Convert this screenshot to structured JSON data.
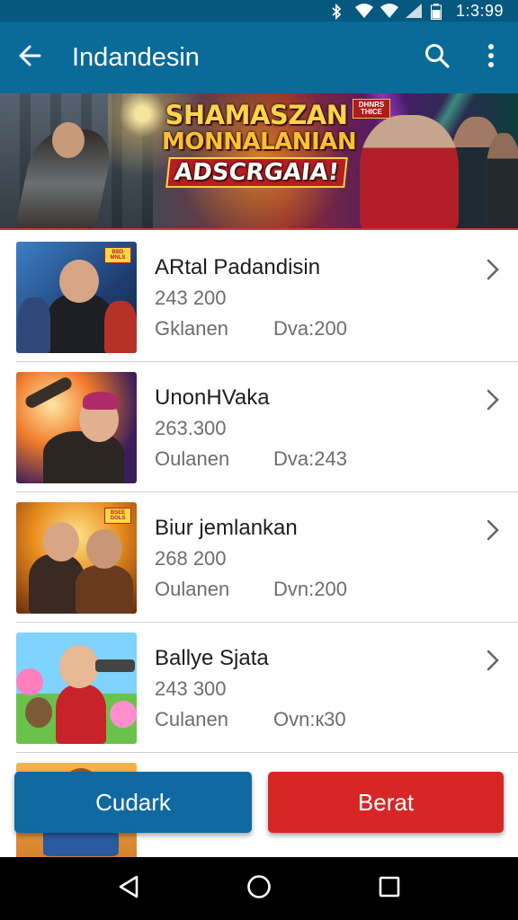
{
  "status_bar": {
    "time": "1:3:99",
    "icons": [
      "bluetooth-icon",
      "wifi-icon",
      "signal-icon",
      "battery-icon"
    ]
  },
  "app_bar": {
    "title": "Indandesin",
    "icons": [
      "back-arrow-icon",
      "search-icon",
      "more-vert-icon"
    ]
  },
  "banner": {
    "headline_1": "SHAMASZAN",
    "headline_2": "MONNALANIAN",
    "headline_3": "ADSCRGAIA!",
    "corner_badge": "DHNRS THICE"
  },
  "list": [
    {
      "name": "ARtal Padandisin",
      "count": "243 200",
      "meta_left": "Gklanen",
      "meta_right": "Dva:200",
      "badge": "BBD MNLS"
    },
    {
      "name": "UnonHVaka",
      "count": "263.300",
      "meta_left": "Oulanen",
      "meta_right": "Dva:243",
      "badge": ""
    },
    {
      "name": "Biur jemlankan",
      "count": "268 200",
      "meta_left": "Oulanen",
      "meta_right": "Dvn:200",
      "badge": "BSEE GOLS"
    },
    {
      "name": "Ballye Sjata",
      "count": "243 300",
      "meta_left": "Culanen",
      "meta_right": "Ovn:к30",
      "badge": ""
    }
  ],
  "buttons": {
    "left_label": "Cudark",
    "right_label": "Berat"
  },
  "colors": {
    "app_bar": "#0a6a98",
    "status_bar": "#06587e",
    "left_button": "#1069a0",
    "right_button": "#d82626"
  }
}
